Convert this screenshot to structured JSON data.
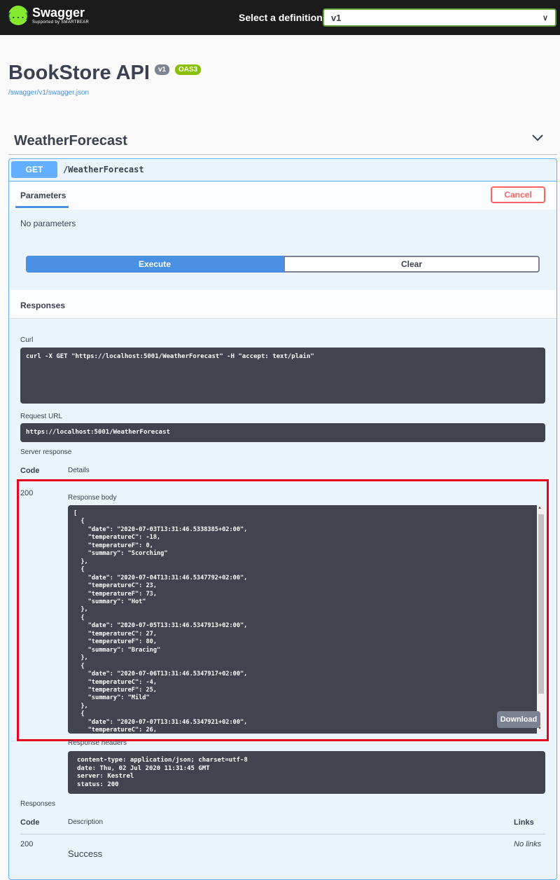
{
  "topbar": {
    "logo_name": "Swagger",
    "logo_tag": "Supported by SMARTBEAR",
    "logo_icon": "{...}",
    "definition_label": "Select a definition",
    "definition_value": "v1"
  },
  "info": {
    "title": "BookStore API",
    "version_badge": "v1",
    "oas_badge": "OAS3",
    "spec_url": "/swagger/v1/swagger.json"
  },
  "tag": {
    "name": "WeatherForecast"
  },
  "operation": {
    "method": "GET",
    "path": "/WeatherForecast",
    "parameters_tab": "Parameters",
    "cancel_label": "Cancel",
    "no_parameters": "No parameters",
    "execute_label": "Execute",
    "clear_label": "Clear"
  },
  "responses": {
    "title": "Responses",
    "curl_label": "Curl",
    "curl_command": "curl -X GET \"https://localhost:5001/WeatherForecast\" -H \"accept: text/plain\"",
    "request_url_label": "Request URL",
    "request_url": "https://localhost:5001/WeatherForecast",
    "server_response_label": "Server response",
    "code_header": "Code",
    "details_header": "Details",
    "response_code": "200",
    "response_body_label": "Response body",
    "response_body": "[\n  {\n    \"date\": \"2020-07-03T13:31:46.5338385+02:00\",\n    \"temperatureC\": -18,\n    \"temperatureF\": 0,\n    \"summary\": \"Scorching\"\n  },\n  {\n    \"date\": \"2020-07-04T13:31:46.5347792+02:00\",\n    \"temperatureC\": 23,\n    \"temperatureF\": 73,\n    \"summary\": \"Hot\"\n  },\n  {\n    \"date\": \"2020-07-05T13:31:46.5347913+02:00\",\n    \"temperatureC\": 27,\n    \"temperatureF\": 80,\n    \"summary\": \"Bracing\"\n  },\n  {\n    \"date\": \"2020-07-06T13:31:46.5347917+02:00\",\n    \"temperatureC\": -4,\n    \"temperatureF\": 25,\n    \"summary\": \"Mild\"\n  },\n  {\n    \"date\": \"2020-07-07T13:31:46.5347921+02:00\",\n    \"temperatureC\": 26,",
    "download_label": "Download",
    "response_headers_label": "Response headers",
    "response_headers": "content-type: application/json; charset=utf-8\ndate: Thu, 02 Jul 2020 11:31:45 GMT\nserver: Kestrel\nstatus: 200"
  },
  "documented_responses": {
    "title": "Responses",
    "code_header": "Code",
    "description_header": "Description",
    "links_header": "Links",
    "code": "200",
    "description": "Success",
    "links": "No links"
  },
  "colors": {
    "topbar_bg": "#1b1b1b",
    "logo_green": "#85ea2d",
    "get_blue": "#61affe",
    "execute_blue": "#4990e2",
    "cancel_red": "#ff6060",
    "highlight_red": "#e8001c",
    "code_bg": "#41444e"
  }
}
